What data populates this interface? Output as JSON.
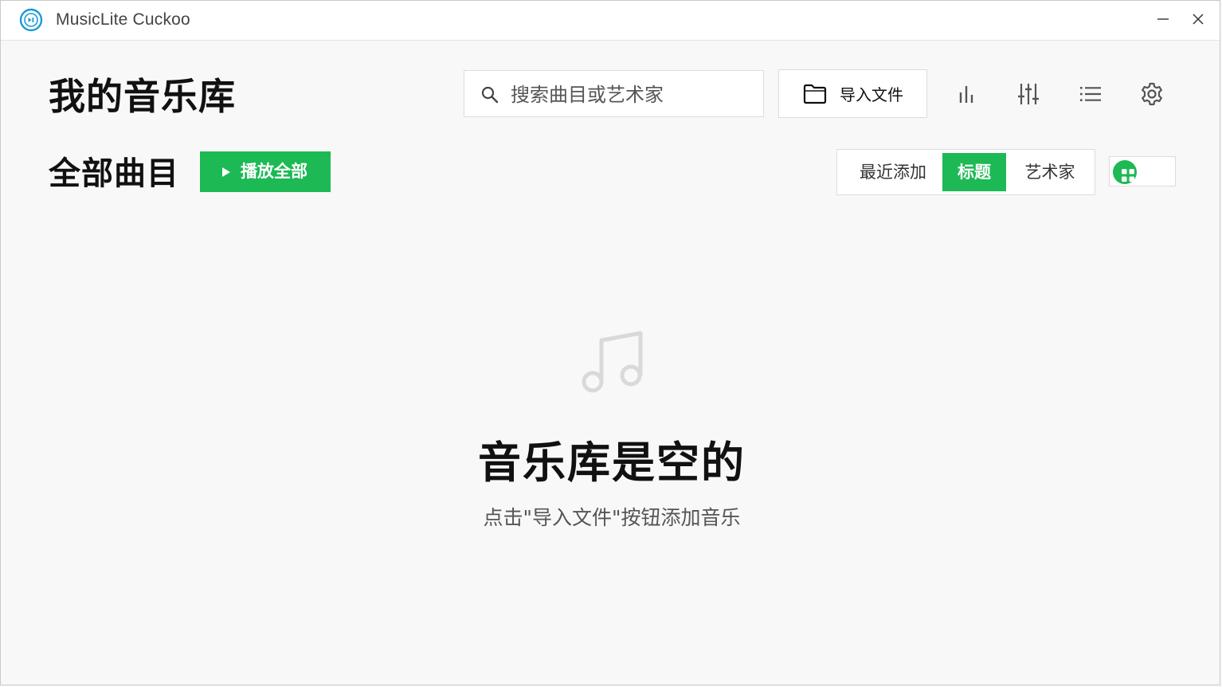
{
  "window": {
    "title": "MusicLite Cuckoo"
  },
  "header": {
    "page_title": "我的音乐库",
    "search_placeholder": "搜索曲目或艺术家",
    "import_label": "导入文件"
  },
  "toolbar": {
    "icons": [
      "stats-icon",
      "equalizer-icon",
      "list-icon",
      "settings-icon"
    ]
  },
  "library": {
    "section_title": "全部曲目",
    "play_all_label": "播放全部",
    "sort_tabs": [
      {
        "label": "最近添加",
        "active": false
      },
      {
        "label": "标题",
        "active": true
      },
      {
        "label": "艺术家",
        "active": false
      }
    ]
  },
  "empty_state": {
    "title": "音乐库是空的",
    "subtitle": "点击\"导入文件\"按钮添加音乐"
  },
  "colors": {
    "accent": "#1db954",
    "app_icon": "#1a9ad6"
  }
}
